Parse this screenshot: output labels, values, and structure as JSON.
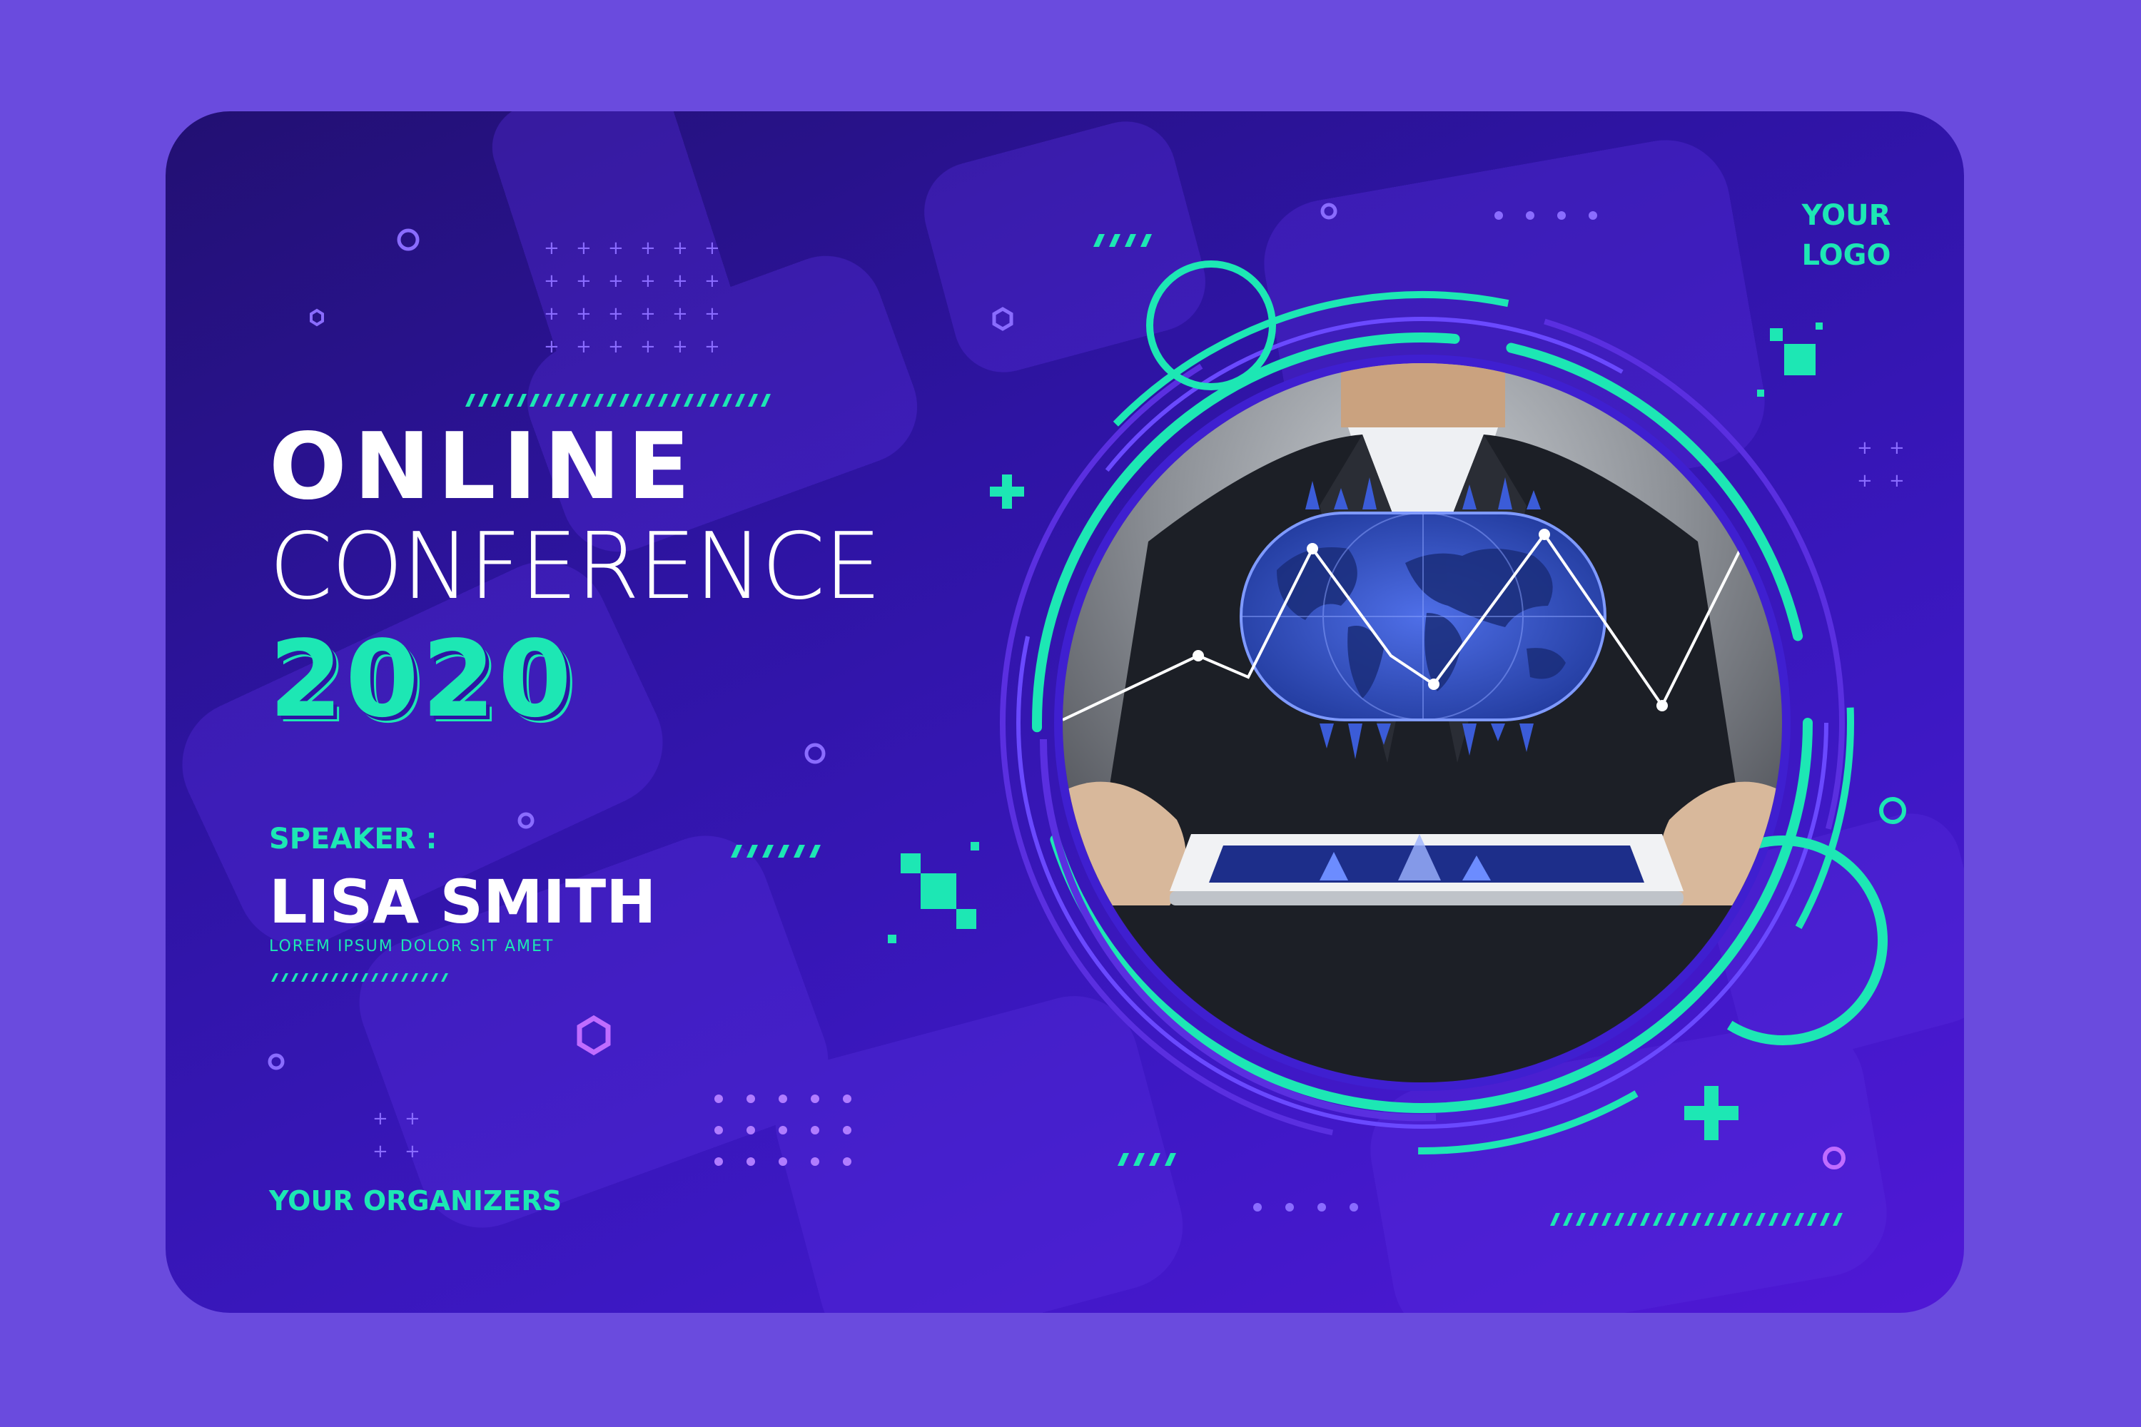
{
  "colors": {
    "page_background": "#6a4bde",
    "accent_teal": "#1de7b4",
    "text_white": "#ffffff",
    "card_dark_purple": "#221072"
  },
  "logo": {
    "line1": "YOUR",
    "line2": "LOGO"
  },
  "headline": {
    "line1": "ONLINE",
    "line2": "CONFERENCE",
    "year": "2020"
  },
  "speaker": {
    "label": "SPEAKER :",
    "name": "LISA SMITH",
    "subtitle": "LOREM IPSUM DOLOR SIT AMET"
  },
  "footer": {
    "organizers": "YOUR ORGANIZERS"
  },
  "photo": {
    "description_icon": "businessman-holding-tablet-hologram-icon"
  }
}
